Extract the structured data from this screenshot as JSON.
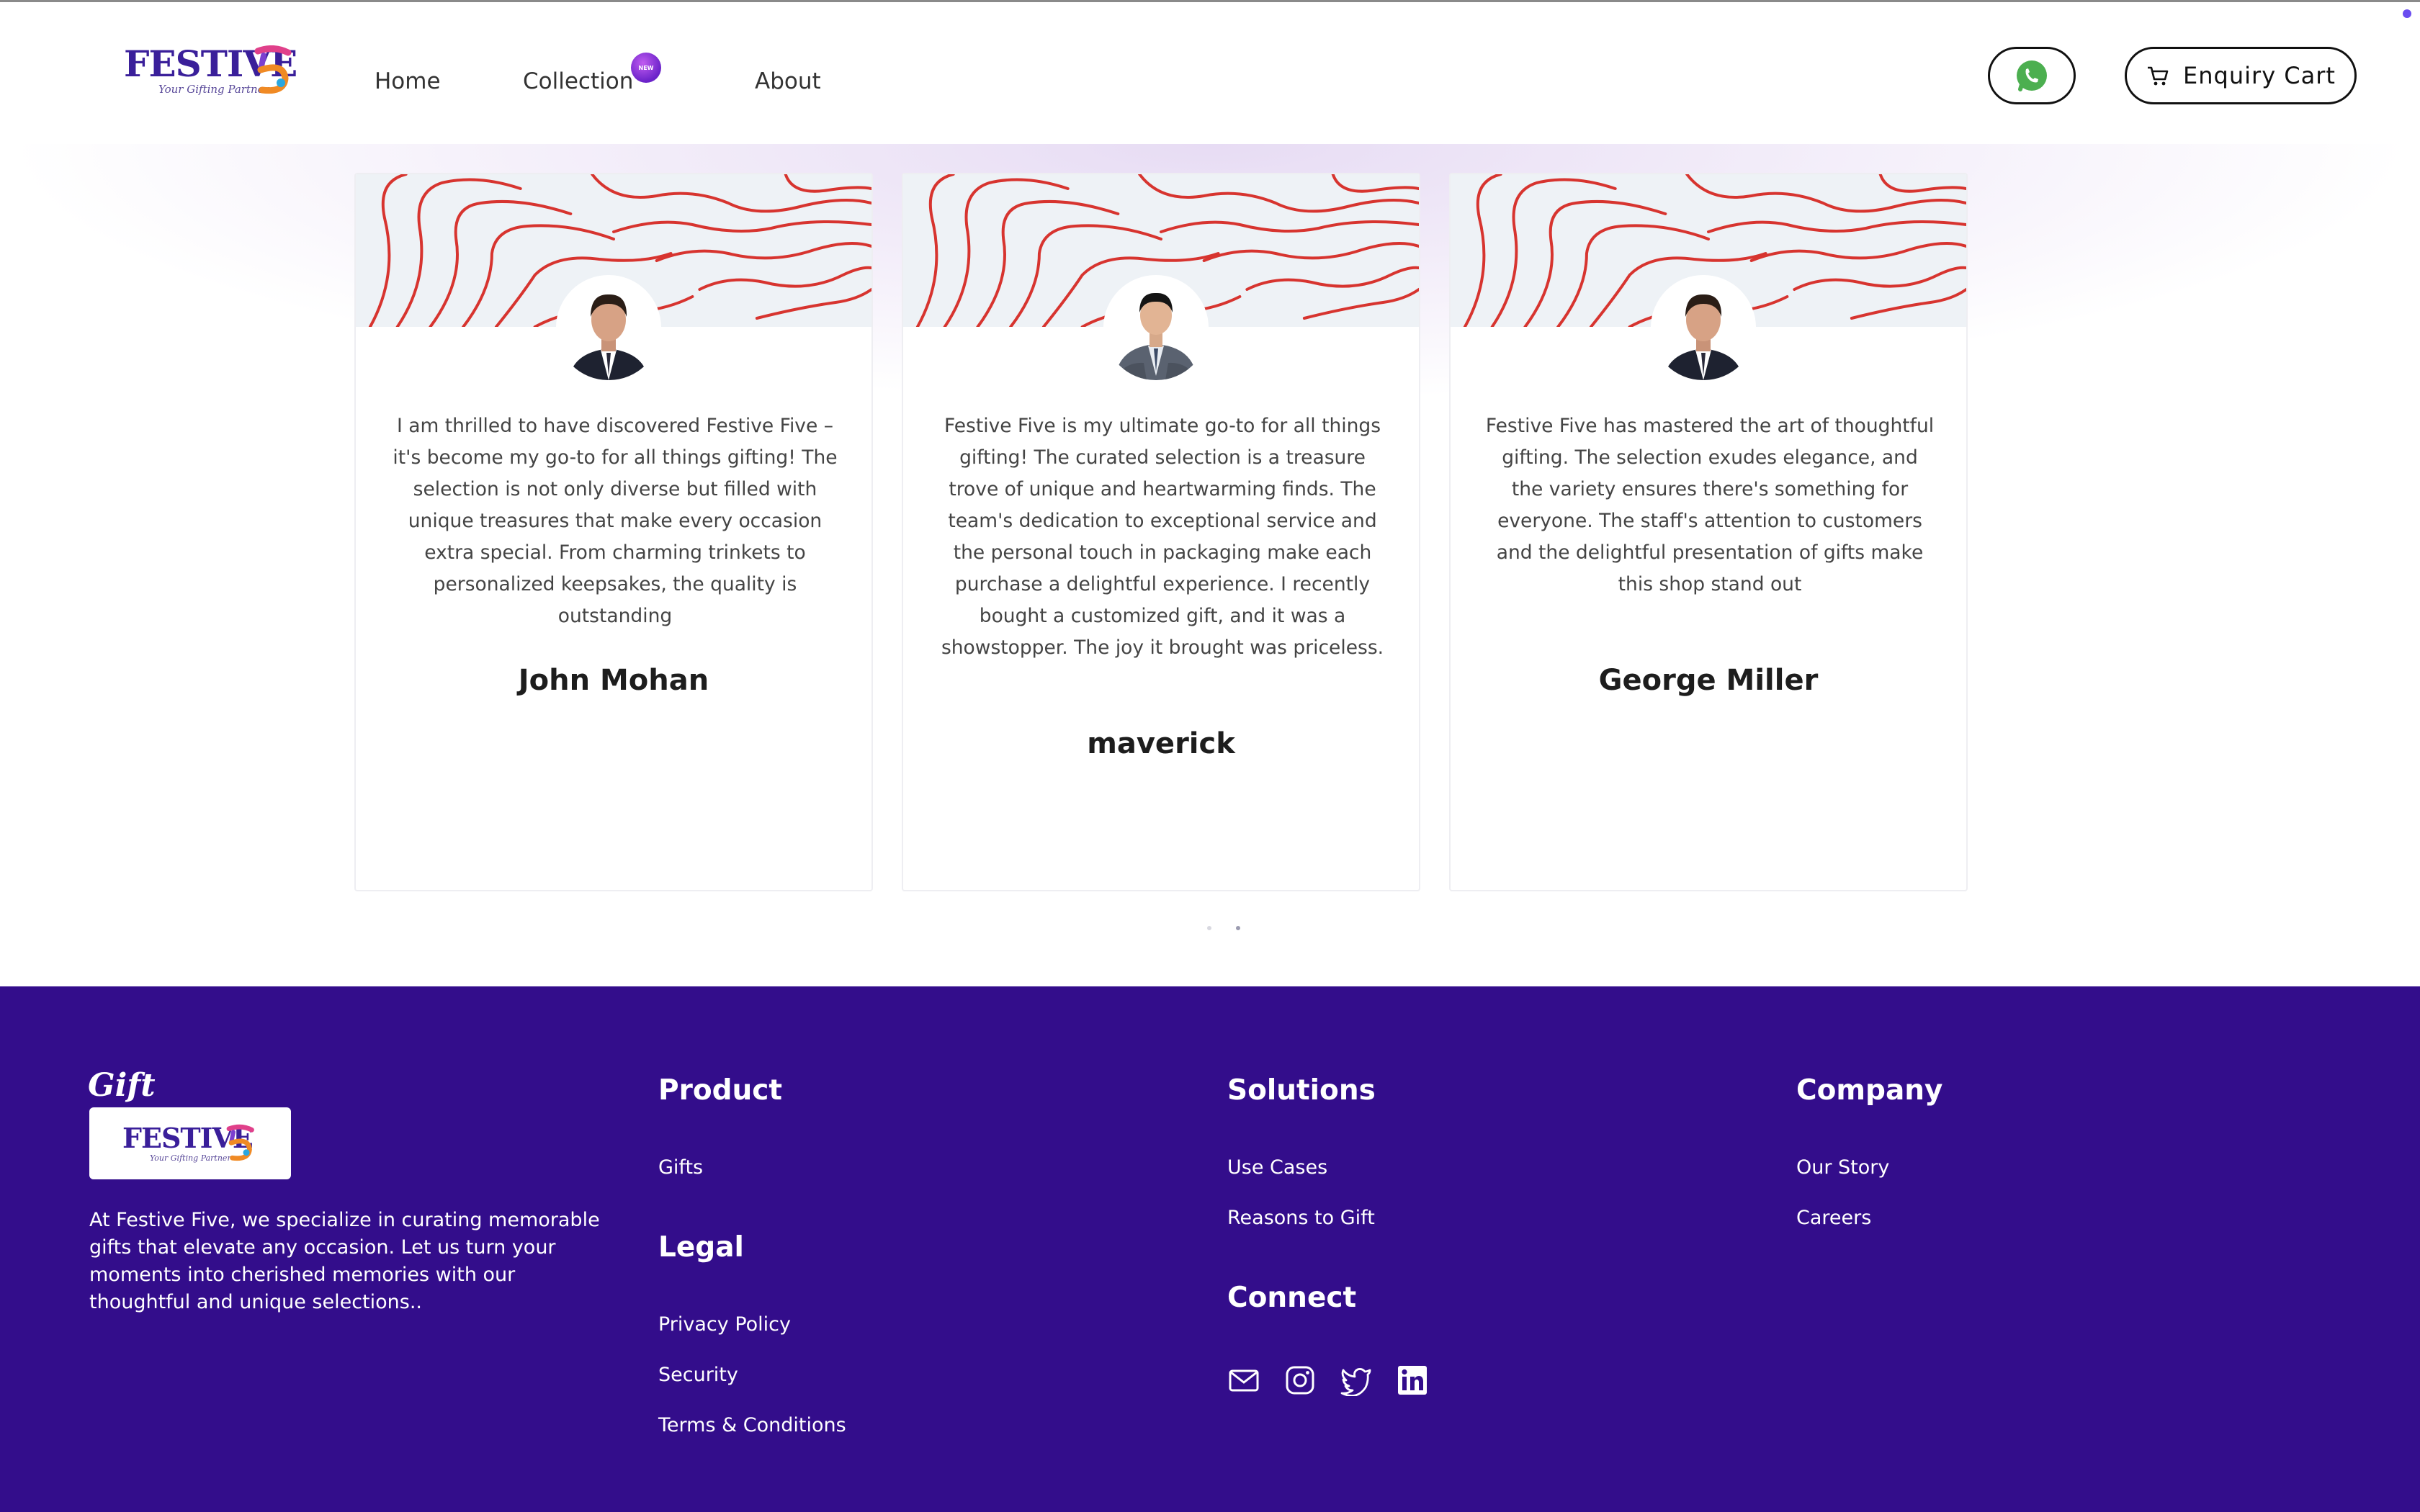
{
  "header": {
    "logo_text": "FESTIVE",
    "logo_tagline": "Your Gifting Partner",
    "nav": [
      {
        "label": "Home"
      },
      {
        "label": "Collection",
        "badge": "NEW"
      },
      {
        "label": "About"
      }
    ],
    "whatsapp_icon": "whatsapp-icon",
    "cart_label": "Enquiry Cart",
    "cart_icon": "cart-icon"
  },
  "testimonials": [
    {
      "quote": "I am thrilled to have discovered Festive Five – it's become my go-to for all things gifting! The selection is not only diverse but filled with unique treasures that make every occasion extra special. From charming trinkets to personalized keepsakes, the quality is outstanding",
      "name": "John Mohan"
    },
    {
      "quote": "Festive Five is my ultimate go-to for all things gifting! The curated selection is a treasure trove of unique and heartwarming finds. The team's dedication to exceptional service and the personal touch in packaging make each purchase a delightful experience. I recently bought a customized gift, and it was a showstopper. The joy it brought was priceless.",
      "name": "maverick"
    },
    {
      "quote": "Festive Five has mastered the art of thoughtful gifting. The selection exudes elegance, and the variety ensures there's something for everyone. The staff's attention to customers and the delightful presentation of gifts make this shop stand out",
      "name": "George Miller"
    }
  ],
  "carousel": {
    "total": 2,
    "active": 2
  },
  "footer": {
    "gift_script": "Gift",
    "logo_text": "FESTIVE",
    "logo_tagline": "Your Gifting Partner",
    "description": "At Festive Five, we specialize in curating memorable gifts that elevate any occasion. Let us turn your moments into cherished memories with our thoughtful and unique selections..",
    "product": {
      "heading": "Product",
      "links": [
        "Gifts"
      ]
    },
    "legal": {
      "heading": "Legal",
      "links": [
        "Privacy Policy",
        "Security",
        "Terms & Conditions"
      ]
    },
    "solutions": {
      "heading": "Solutions",
      "links": [
        "Use Cases",
        "Reasons to Gift"
      ]
    },
    "connect": {
      "heading": "Connect",
      "icons": [
        "mail-icon",
        "instagram-icon",
        "twitter-icon",
        "linkedin-icon"
      ]
    },
    "company": {
      "heading": "Company",
      "links": [
        "Our Story",
        "Careers"
      ]
    }
  },
  "colors": {
    "brand_purple": "#330d8b",
    "wave_red": "#d7342f",
    "whatsapp_green": "#4caf50"
  }
}
